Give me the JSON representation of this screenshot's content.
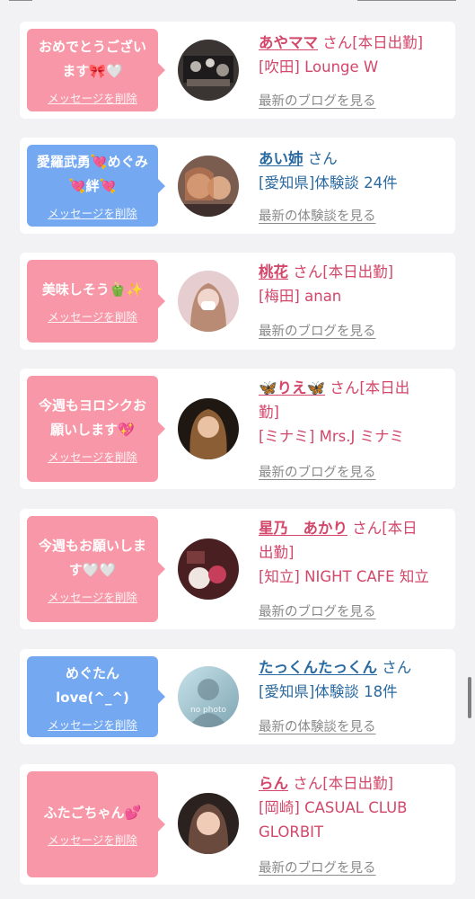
{
  "cards": [
    {
      "message": "おめでとうござい\nます🎀🤍",
      "delete": "メッセージを削除",
      "name": "あやママ",
      "suffix": " さん[本日出勤]",
      "sub": "[吹田] Lounge W",
      "link": "最新のブログを見る",
      "color": "pink"
    },
    {
      "message": "愛羅武勇💘めぐみ\n💘絆💘",
      "delete": "メッセージを削除",
      "name": "あい姉",
      "suffix": " さん",
      "sub": "[愛知県]体験談 24件",
      "link": "最新の体験談を見る",
      "color": "blue"
    },
    {
      "message": "美味しそう🫑✨",
      "delete": "メッセージを削除",
      "name": "桃花",
      "suffix": " さん[本日出勤]",
      "sub": "[梅田] anan",
      "link": "最新のブログを見る",
      "color": "pink"
    },
    {
      "message": "今週もヨロシクお\n願いします💖",
      "delete": "メッセージを削除",
      "name": "🦋りえ🦋",
      "suffix": " さん[本日出\n勤]",
      "sub": "[ミナミ] Mrs.J ミナミ",
      "link": "最新のブログを見る",
      "color": "pink"
    },
    {
      "message": "今週もお願いしま\nす🤍🤍",
      "delete": "メッセージを削除",
      "name": "星乃　あかり",
      "suffix": " さん[本日\n出勤]",
      "sub": "[知立] NIGHT CAFE 知立",
      "link": "最新のブログを見る",
      "color": "pink"
    },
    {
      "message": "めぐたん\nlove(^_^)",
      "delete": "メッセージを削除",
      "name": "たっくんたっくん",
      "suffix": " さん",
      "sub": "[愛知県]体験談 18件",
      "link": "最新の体験談を見る",
      "color": "blue",
      "avatar_label": "no photo"
    },
    {
      "message": "ふたごちゃん💕",
      "delete": "メッセージを削除",
      "name": "らん",
      "suffix": " さん[本日出勤]",
      "sub": "[岡崎] CASUAL CLUB\nGLORBIT",
      "link": "最新のブログを見る",
      "color": "pink"
    }
  ],
  "colors": {
    "pink": "#f797a7",
    "blue": "#74a9f2",
    "pink_text": "#d2476a",
    "blue_text": "#2a6aa0"
  }
}
